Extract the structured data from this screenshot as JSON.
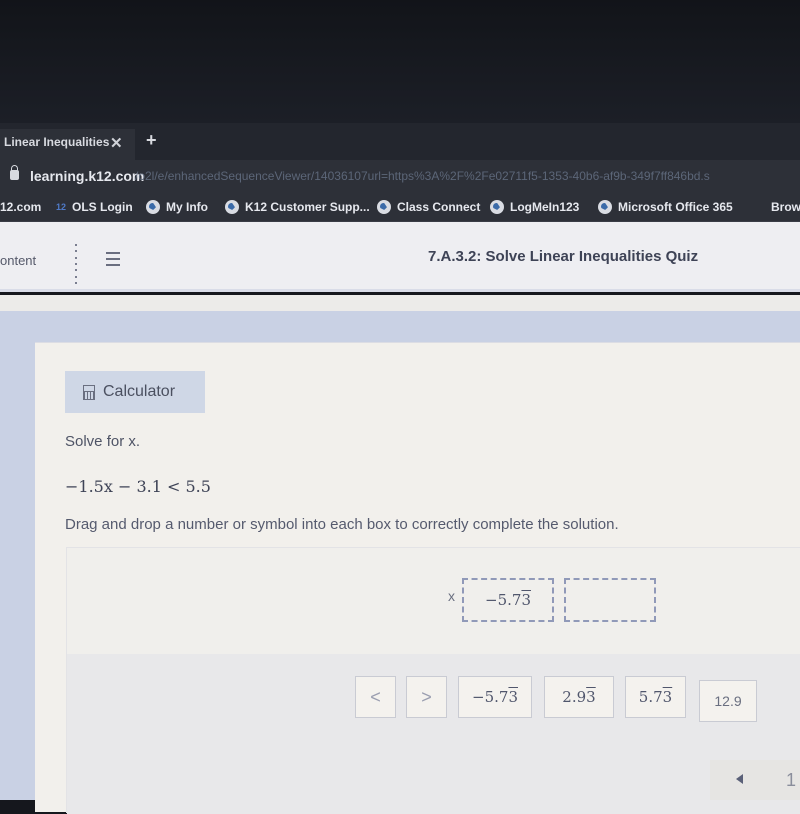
{
  "browser": {
    "tab": {
      "title": "Linear Inequalities",
      "close_glyph": "✕",
      "new_tab_glyph": "+"
    },
    "address": {
      "host": "learning.k12.com",
      "path": "/o2l/e/enhancedSequenceViewer/14036107url=https%3A%2F%2Fe02711f5-1353-40b6-af9b-349f7ff846bd.s"
    },
    "bookmarks": [
      {
        "label": "12.com",
        "icon": "none"
      },
      {
        "label": "OLS Login",
        "icon": "k12-badge",
        "badge": "12"
      },
      {
        "label": "My Info",
        "icon": "globe-icon"
      },
      {
        "label": "K12 Customer Supp...",
        "icon": "globe-icon"
      },
      {
        "label": "Class Connect",
        "icon": "globe-icon"
      },
      {
        "label": "LogMeIn123",
        "icon": "globe-icon"
      },
      {
        "label": "Microsoft Office 365",
        "icon": "globe-icon"
      },
      {
        "label": "Brows",
        "icon": "none"
      }
    ]
  },
  "appbar": {
    "content_link": "ontent",
    "title": "7.A.3.2: Solve Linear Inequalities Quiz"
  },
  "question": {
    "calculator_label": "Calculator",
    "prompt": "Solve for x.",
    "equation": "−1.5x − 3.1 < 5.5",
    "instructions": "Drag and drop a number or symbol into each box to correctly complete the solution."
  },
  "answer": {
    "variable": "x",
    "boxes": [
      {
        "base": "−5.7",
        "repeating": "3"
      },
      {
        "base": "",
        "repeating": ""
      }
    ]
  },
  "tiles": [
    {
      "type": "symbol",
      "label": "<"
    },
    {
      "type": "symbol",
      "label": ">"
    },
    {
      "type": "number",
      "base": "−5.7",
      "repeating": "3"
    },
    {
      "type": "number",
      "base": "2.9",
      "repeating": "3"
    },
    {
      "type": "number",
      "base": "5.7",
      "repeating": "3"
    },
    {
      "type": "plain",
      "label": "12.9"
    }
  ],
  "pager": {
    "current": "1"
  },
  "colors": {
    "calc_bg": "#cfd7e6",
    "page_bg": "#c9d1e4",
    "dash_border": "#9099b8"
  }
}
